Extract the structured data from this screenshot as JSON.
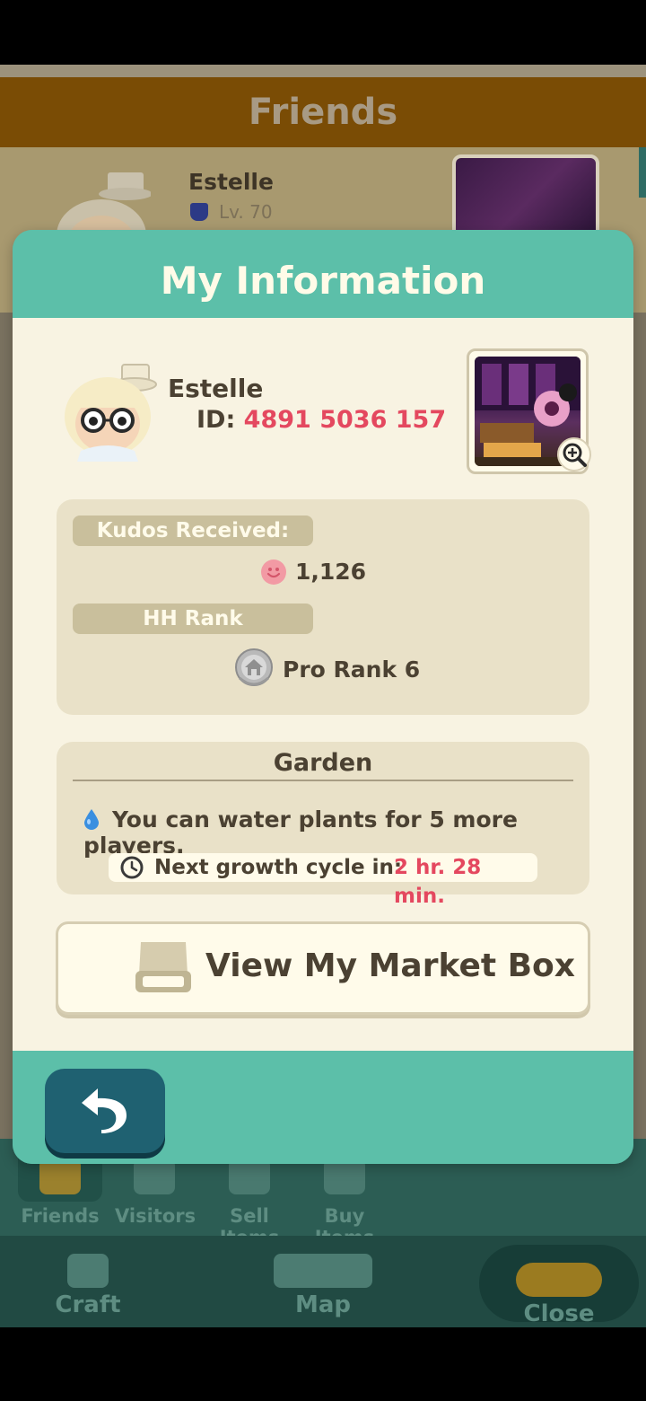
{
  "background": {
    "header_title": "Friends",
    "friend": {
      "name": "Estelle",
      "level": "Lv. 70"
    },
    "subnav": [
      {
        "label": "Friends",
        "icon": "friends-icon"
      },
      {
        "label": "Visitors",
        "icon": "footprints-icon"
      },
      {
        "label": "Sell Items",
        "icon": "market-box-icon"
      },
      {
        "label": "Buy Items",
        "icon": "shopping-icon"
      }
    ],
    "mainnav": [
      {
        "label": "Craft",
        "icon": "hammer-icon"
      },
      {
        "label": "Map",
        "icon": "map-icon"
      },
      {
        "label": "Close",
        "icon": "villagers-icon"
      }
    ]
  },
  "dialog": {
    "title": "My Information",
    "profile": {
      "name": "Estelle",
      "id_label": "ID:",
      "id_value": "4891 5036 157"
    },
    "stats": {
      "kudos_label": "Kudos Received:",
      "kudos_value": "1,126",
      "rank_label": "HH Rank",
      "rank_value": "Pro Rank 6"
    },
    "garden": {
      "title": "Garden",
      "water_text": "You can water plants for 5 more players.",
      "growth_label": "Next growth cycle in:",
      "growth_time": "2 hr. 28 min."
    },
    "market_button": "View My Market Box"
  },
  "colors": {
    "accent_teal": "#5cbfa9",
    "highlight_red": "#e4485f",
    "card_bg": "#e9e1c8",
    "dialog_bg": "#f8f3e2",
    "back_button": "#1f6171"
  }
}
